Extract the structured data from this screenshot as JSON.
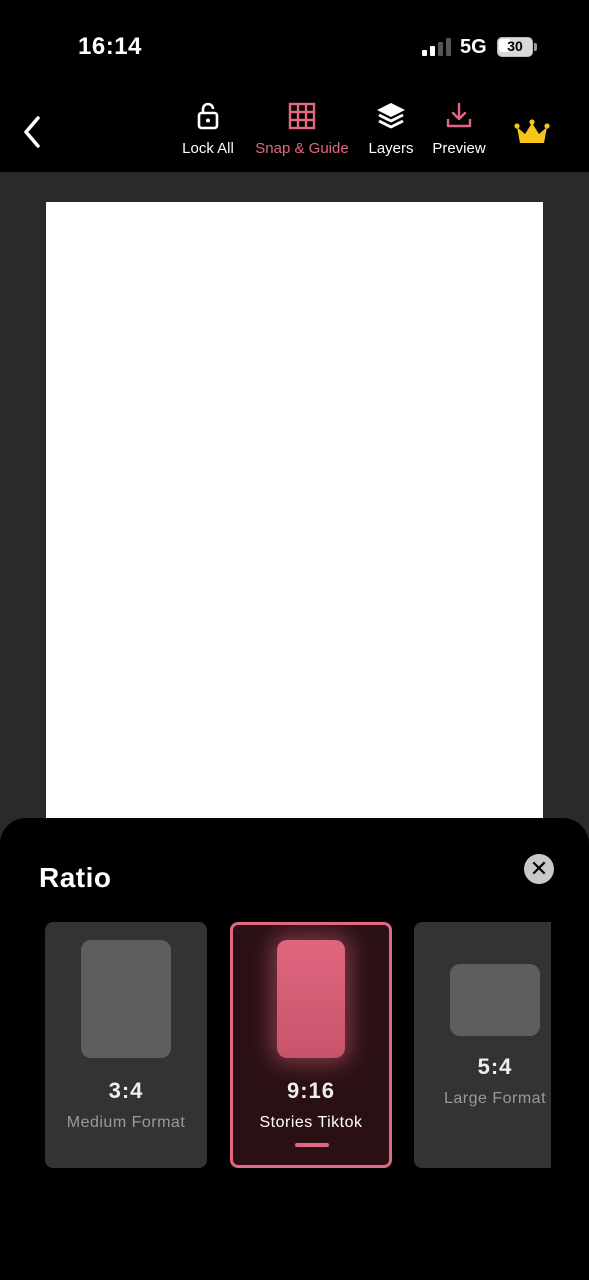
{
  "status_bar": {
    "time": "16:14",
    "network": "5G",
    "battery": "30"
  },
  "toolbar": {
    "tools": [
      {
        "label": "Lock All",
        "icon": "lock-icon"
      },
      {
        "label": "Snap & Guide",
        "icon": "grid-icon",
        "active": true
      },
      {
        "label": "Layers",
        "icon": "layers-icon"
      },
      {
        "label": "Preview",
        "icon": "download-icon"
      }
    ],
    "premium_icon": "crown-icon"
  },
  "colors": {
    "accent": "#e0697f",
    "crown": "#f5c518",
    "workspace": "#2a2a2a"
  },
  "sheet": {
    "title": "Ratio",
    "ratios": [
      {
        "value": "3:4",
        "name": "Medium Format"
      },
      {
        "value": "9:16",
        "name": "Stories Tiktok",
        "selected": true
      },
      {
        "value": "5:4",
        "name": "Large Format"
      }
    ]
  }
}
